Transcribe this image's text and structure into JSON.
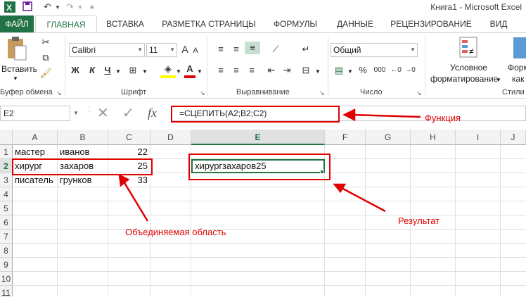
{
  "window": {
    "title": "Книга1 - Microsoft Excel"
  },
  "tabs": {
    "file": "ФАЙЛ",
    "home": "ГЛАВНАЯ",
    "insert": "ВСТАВКА",
    "layout": "РАЗМЕТКА СТРАНИЦЫ",
    "formulas": "ФОРМУЛЫ",
    "data": "ДАННЫЕ",
    "review": "РЕЦЕНЗИРОВАНИЕ",
    "view": "ВИД"
  },
  "ribbon": {
    "clipboard": {
      "paste": "Вставить",
      "label": "Буфер обмена"
    },
    "font": {
      "name": "Calibri",
      "size": "11",
      "bold": "Ж",
      "italic": "К",
      "underline": "Ч",
      "grow": "A",
      "shrink": "A",
      "color_a": "A",
      "label": "Шрифт"
    },
    "alignment": {
      "label": "Выравнивание"
    },
    "number": {
      "format": "Общий",
      "percent": "%",
      "thousands": "000",
      "label": "Число"
    },
    "styles": {
      "conditional": "Условное",
      "conditional2": "форматирование",
      "format_table": "Форм",
      "format_table2": "как",
      "label": "Стили"
    }
  },
  "formula_bar": {
    "name_box": "E2",
    "fx": "fx",
    "formula": "=СЦЕПИТЬ(A2;B2;C2)"
  },
  "grid": {
    "columns": [
      "A",
      "B",
      "C",
      "D",
      "E",
      "F",
      "G",
      "H",
      "I",
      "J"
    ],
    "rows": [
      "1",
      "2",
      "3",
      "4",
      "5",
      "6",
      "7",
      "8",
      "9",
      "10",
      "11"
    ],
    "cells": {
      "A1": "мастер",
      "B1": "иванов",
      "C1": "22",
      "A2": "хирург",
      "B2": "захаров",
      "C2": "25",
      "A3": "писатель",
      "B3": "грунков",
      "C3": "33",
      "E2": "хирургзахаров25"
    }
  },
  "annotations": {
    "function": "Функция",
    "merged_area": "Объединяемая область",
    "result": "Результат"
  },
  "colors": {
    "accent": "#217346",
    "annotation": "#e00000"
  }
}
